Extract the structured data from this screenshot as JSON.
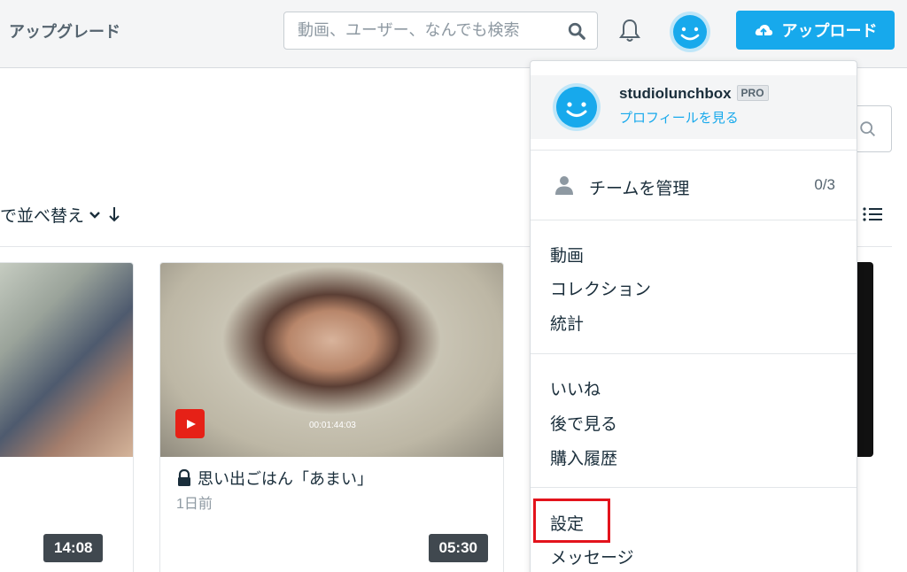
{
  "topbar": {
    "upgrade_label": "アップグレード",
    "search_placeholder": "動画、ユーザー、なんでも検索",
    "upload_label": "アップロード"
  },
  "page": {
    "sort_label": "で並べ替え",
    "divider_color": "#e3e6e9"
  },
  "cards": [
    {
      "duration": "14:08"
    },
    {
      "duration": "05:30",
      "timestamp": "00:01:44:03",
      "title": "思い出ごはん「あまい」",
      "date": "1日前"
    }
  ],
  "dropdown": {
    "username": "studiolunchbox",
    "badge": "PRO",
    "profile_link": "プロフィールを見る",
    "team": {
      "label": "チームを管理",
      "count": "0/3"
    },
    "group1": [
      "動画",
      "コレクション",
      "統計"
    ],
    "group2": [
      "いいね",
      "後で見る",
      "購入履歴"
    ],
    "group3": [
      "設定",
      "メッセージ"
    ]
  },
  "colors": {
    "accent": "#17a9ec",
    "highlight": "#e3131c",
    "text": "#1a2e3b"
  }
}
